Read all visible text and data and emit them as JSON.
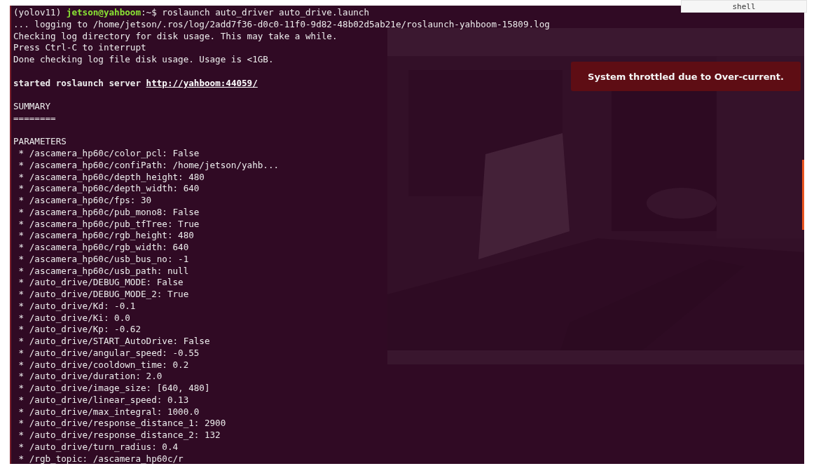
{
  "tab": {
    "label": "shell"
  },
  "notification": {
    "text": "System throttled due to Over-current."
  },
  "terminal": {
    "lines": [
      {
        "kind": "prompt",
        "env": "(yolov11) ",
        "user_host": "jetson@yahboom",
        "path": ":~$",
        "command": " roslaunch auto_driver auto_drive.launch"
      },
      {
        "kind": "plain",
        "text": "... logging to /home/jetson/.ros/log/2add7f36-d0c0-11f0-9d82-48b02d5ab21e/roslaunch-yahboom-15809.log"
      },
      {
        "kind": "plain",
        "text": "Checking log directory for disk usage. This may take a while."
      },
      {
        "kind": "plain",
        "text": "Press Ctrl-C to interrupt"
      },
      {
        "kind": "plain",
        "text": "Done checking log file disk usage. Usage is <1GB."
      },
      {
        "kind": "blank"
      },
      {
        "kind": "server",
        "text": "started roslaunch server ",
        "link": "http://yahboom:44059/"
      },
      {
        "kind": "blank"
      },
      {
        "kind": "plain",
        "text": "SUMMARY"
      },
      {
        "kind": "plain",
        "text": "========"
      },
      {
        "kind": "blank"
      },
      {
        "kind": "plain",
        "text": "PARAMETERS"
      },
      {
        "kind": "plain",
        "text": " * /ascamera_hp60c/color_pcl: False"
      },
      {
        "kind": "plain",
        "text": " * /ascamera_hp60c/confiPath: /home/jetson/yahb..."
      },
      {
        "kind": "plain",
        "text": " * /ascamera_hp60c/depth_height: 480"
      },
      {
        "kind": "plain",
        "text": " * /ascamera_hp60c/depth_width: 640"
      },
      {
        "kind": "plain",
        "text": " * /ascamera_hp60c/fps: 30"
      },
      {
        "kind": "plain",
        "text": " * /ascamera_hp60c/pub_mono8: False"
      },
      {
        "kind": "plain",
        "text": " * /ascamera_hp60c/pub_tfTree: True"
      },
      {
        "kind": "plain",
        "text": " * /ascamera_hp60c/rgb_height: 480"
      },
      {
        "kind": "plain",
        "text": " * /ascamera_hp60c/rgb_width: 640"
      },
      {
        "kind": "plain",
        "text": " * /ascamera_hp60c/usb_bus_no: -1"
      },
      {
        "kind": "plain",
        "text": " * /ascamera_hp60c/usb_path: null"
      },
      {
        "kind": "plain",
        "text": " * /auto_drive/DEBUG_MODE: False"
      },
      {
        "kind": "plain",
        "text": " * /auto_drive/DEBUG_MODE_2: True"
      },
      {
        "kind": "plain",
        "text": " * /auto_drive/Kd: -0.1"
      },
      {
        "kind": "plain",
        "text": " * /auto_drive/Ki: 0.0"
      },
      {
        "kind": "plain",
        "text": " * /auto_drive/Kp: -0.62"
      },
      {
        "kind": "plain",
        "text": " * /auto_drive/START_AutoDrive: False"
      },
      {
        "kind": "plain",
        "text": " * /auto_drive/angular_speed: -0.55"
      },
      {
        "kind": "plain",
        "text": " * /auto_drive/cooldown_time: 0.2"
      },
      {
        "kind": "plain",
        "text": " * /auto_drive/duration: 2.0"
      },
      {
        "kind": "plain",
        "text": " * /auto_drive/image_size: [640, 480]"
      },
      {
        "kind": "plain",
        "text": " * /auto_drive/linear_speed: 0.13"
      },
      {
        "kind": "plain",
        "text": " * /auto_drive/max_integral: 1000.0"
      },
      {
        "kind": "plain",
        "text": " * /auto_drive/response_distance_1: 2900"
      },
      {
        "kind": "plain",
        "text": " * /auto_drive/response_distance_2: 132"
      },
      {
        "kind": "plain",
        "text": " * /auto_drive/turn_radius: 0.4"
      },
      {
        "kind": "plain",
        "text": " * /rgb_topic: /ascamera_hp60c/r"
      }
    ]
  }
}
